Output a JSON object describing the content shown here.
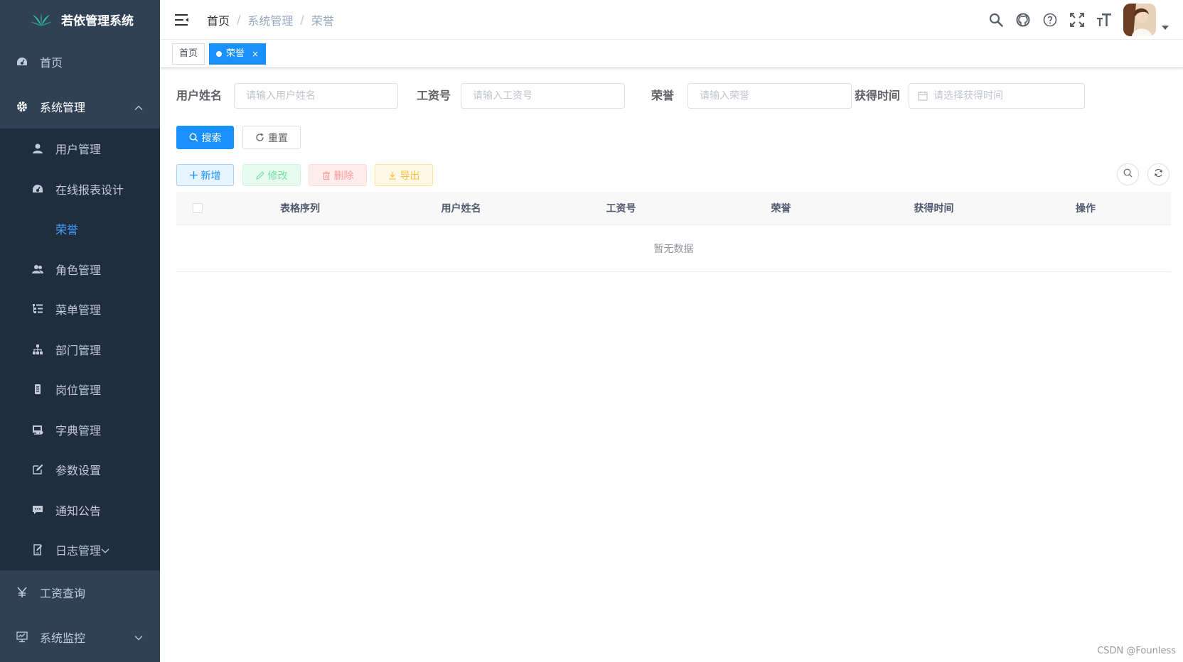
{
  "app": {
    "title": "若依管理系统"
  },
  "sidebar": {
    "items": [
      {
        "label": "首页",
        "icon": "dashboard-icon"
      },
      {
        "label": "系统管理",
        "icon": "gear-icon"
      },
      {
        "label": "工资查询",
        "icon": "yen-icon"
      },
      {
        "label": "系统监控",
        "icon": "monitor-icon"
      }
    ],
    "system_submenu": [
      {
        "label": "用户管理",
        "icon": "user-icon"
      },
      {
        "label": "在线报表设计",
        "icon": "dashboard-icon"
      },
      {
        "label": "荣誉",
        "icon": "",
        "active": true
      },
      {
        "label": "角色管理",
        "icon": "peoples-icon"
      },
      {
        "label": "菜单管理",
        "icon": "tree-table-icon"
      },
      {
        "label": "部门管理",
        "icon": "tree-icon"
      },
      {
        "label": "岗位管理",
        "icon": "post-icon"
      },
      {
        "label": "字典管理",
        "icon": "dict-icon"
      },
      {
        "label": "参数设置",
        "icon": "edit-icon"
      },
      {
        "label": "通知公告",
        "icon": "message-icon"
      },
      {
        "label": "日志管理",
        "icon": "log-icon"
      }
    ]
  },
  "navbar": {
    "breadcrumb": [
      "首页",
      "系统管理",
      "荣誉"
    ],
    "separator": "/",
    "icons": [
      "search-icon",
      "github-icon",
      "question-icon",
      "fullscreen-icon",
      "font-size-icon"
    ]
  },
  "tags": [
    {
      "label": "首页",
      "active": false
    },
    {
      "label": "荣誉",
      "active": true,
      "close": "×"
    }
  ],
  "search_form": {
    "username_label": "用户姓名",
    "username_placeholder": "请输入用户姓名",
    "salary_no_label": "工资号",
    "salary_no_placeholder": "请输入工资号",
    "honor_label": "荣誉",
    "honor_placeholder": "请输入荣誉",
    "obtain_time_label": "获得时间",
    "obtain_time_placeholder": "请选择获得时间",
    "search_button": "搜索",
    "reset_button": "重置"
  },
  "toolbar": {
    "add": "新增",
    "edit": "修改",
    "delete": "删除",
    "export": "导出"
  },
  "table": {
    "columns": [
      "表格序列",
      "用户姓名",
      "工资号",
      "荣誉",
      "获得时间",
      "操作"
    ],
    "empty_text": "暂无数据"
  },
  "watermark": "CSDN @Founless",
  "colors": {
    "sidebar_bg": "#304156",
    "submenu_bg": "#1f2d3d",
    "primary": "#1890ff",
    "active_menu": "#409eff"
  }
}
